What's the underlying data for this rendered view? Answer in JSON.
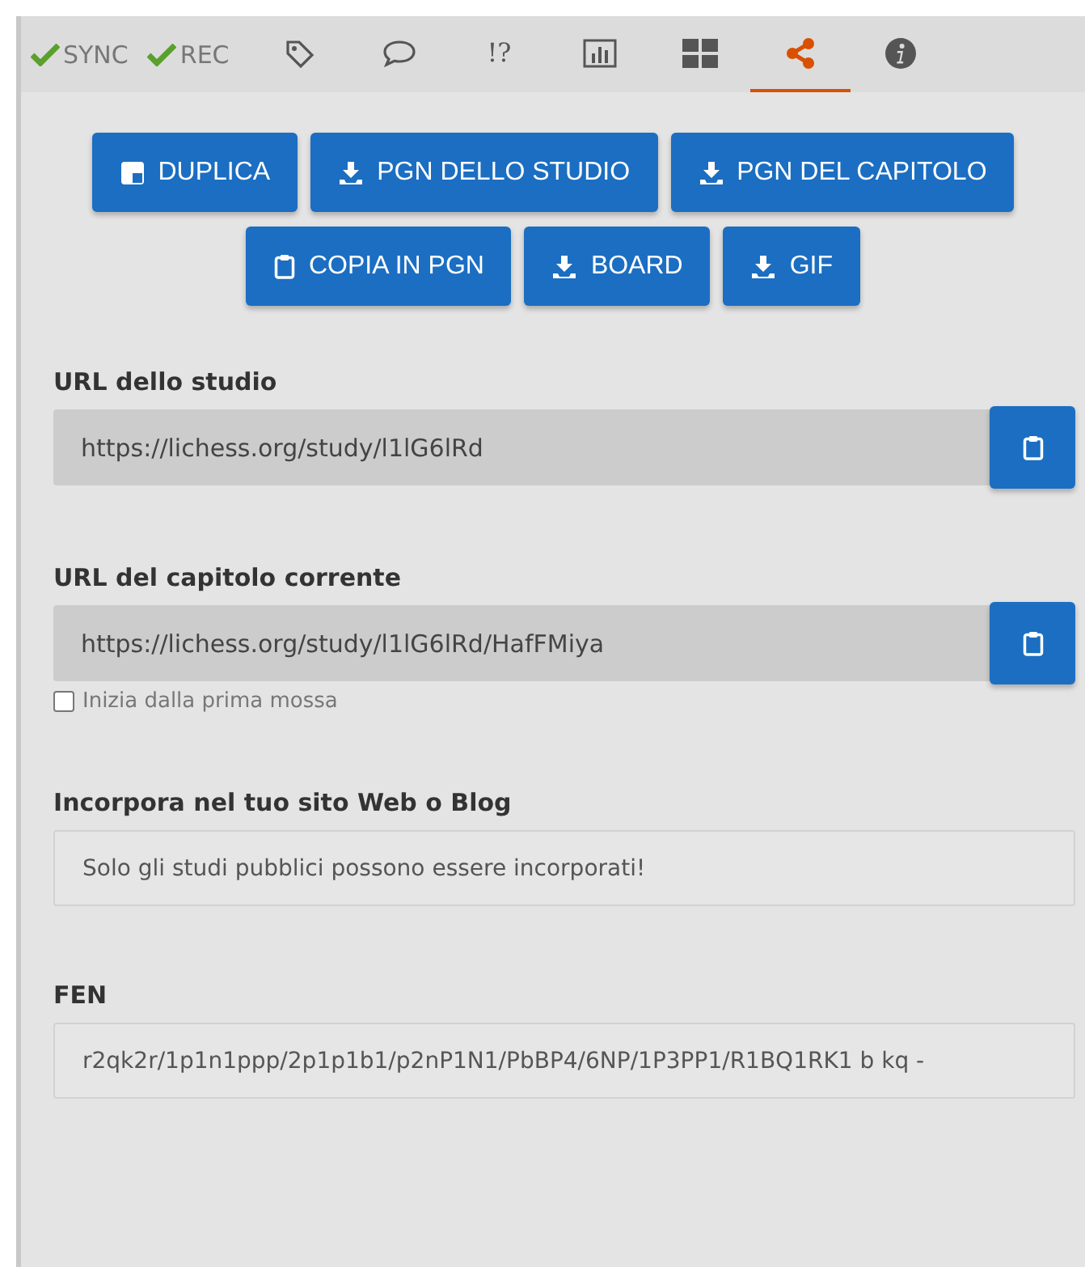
{
  "toolbar": {
    "toggles": [
      {
        "label": "SYNC",
        "on": true
      },
      {
        "label": "REC",
        "on": true
      }
    ],
    "tabs": [
      {
        "kind": "tag",
        "selected": false
      },
      {
        "kind": "comment",
        "selected": false
      },
      {
        "kind": "glyphs",
        "label": "!?",
        "selected": false
      },
      {
        "kind": "chart",
        "selected": false
      },
      {
        "kind": "grid",
        "selected": false
      },
      {
        "kind": "share",
        "selected": true
      },
      {
        "kind": "info",
        "selected": false
      }
    ]
  },
  "button_rows": [
    [
      {
        "kind": "duplicate",
        "label": "DUPLICA"
      },
      {
        "kind": "download",
        "label": "PGN DELLO STUDIO"
      },
      {
        "kind": "download",
        "label": "PGN DEL CAPITOLO"
      }
    ],
    [
      {
        "kind": "clipboard",
        "label": "COPIA IN PGN"
      },
      {
        "kind": "download",
        "label": "BOARD"
      },
      {
        "kind": "download",
        "label": "GIF"
      }
    ]
  ],
  "sections": [
    {
      "kind": "copy",
      "label": "URL dello studio",
      "value": "https://lichess.org/study/l1lG6lRd"
    },
    {
      "kind": "copy",
      "label": "URL del capitolo corrente",
      "value": "https://lichess.org/study/l1lG6lRd/HafFMiya",
      "checkbox": {
        "label": "Inizia dalla prima mossa",
        "checked": false
      }
    },
    {
      "kind": "text",
      "label": "Incorpora nel tuo sito Web o Blog",
      "value": "Solo gli studi pubblici possono essere incorporati!"
    },
    {
      "kind": "text",
      "label": "FEN",
      "value": "r2qk2r/1p1n1ppp/2p1p1b1/p2nP1N1/PbBP4/6NP/1P3PP1/R1BQ1RK1 b kq -"
    }
  ]
}
